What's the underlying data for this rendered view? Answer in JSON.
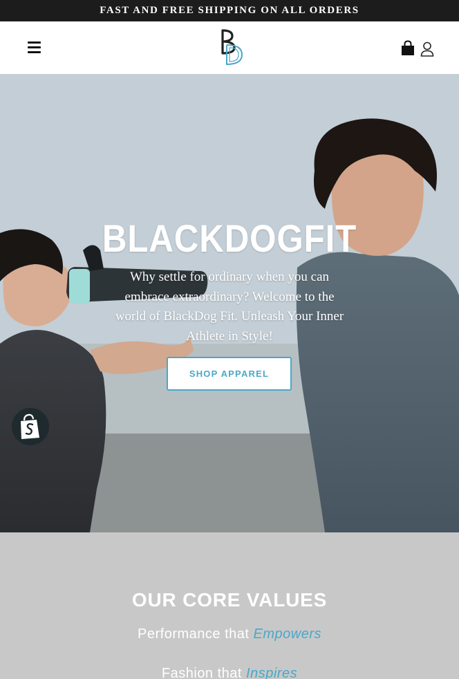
{
  "announcement": {
    "text": "FAST AND FREE SHIPPING ON ALL ORDERS"
  },
  "header": {
    "menu_icon": "hamburger-menu-icon",
    "logo": "blackdogfit-logo",
    "cart_icon": "shopping-bag-icon",
    "account_icon": "user-account-icon"
  },
  "hero": {
    "title": "BLACKDOGFIT",
    "subtitle": "Why settle for ordinary when you can embrace extraordinary? Welcome to the world of BlackDog Fit. Unleash Your Inner Athlete in Style!",
    "cta_label": "SHOP APPAREL"
  },
  "shopify_badge": {
    "icon": "shopify-bag-icon"
  },
  "core_values": {
    "title": "OUR CORE VALUES",
    "items": [
      {
        "prefix": "Performance that",
        "highlight": "Empowers"
      },
      {
        "prefix": "Fashion that",
        "highlight": "Inspires"
      }
    ]
  },
  "colors": {
    "accent": "#49a8c8",
    "announcement_bg": "#1c1c1c",
    "values_bg": "#c8c8c8"
  }
}
